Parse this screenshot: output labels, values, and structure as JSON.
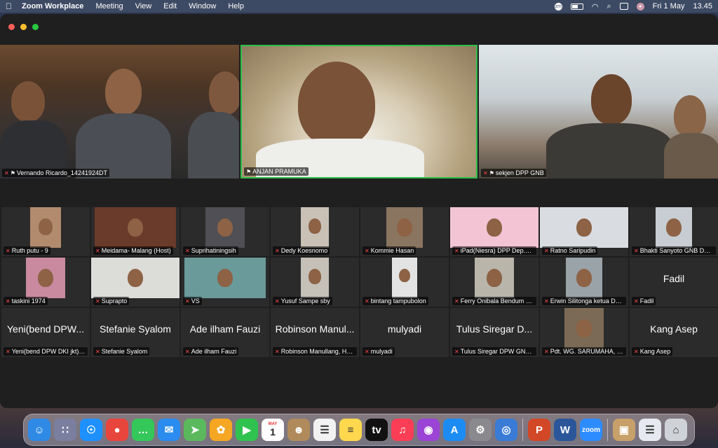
{
  "menubar": {
    "app_name": "Zoom Workplace",
    "menus": [
      "Meeting",
      "View",
      "Edit",
      "Window",
      "Help"
    ],
    "date": "Fri 1 May",
    "time": "13.45"
  },
  "spotlight": [
    {
      "id": "v1",
      "name": "Vernando Ricardo_14241924DT"
    },
    {
      "id": "v2",
      "name": "ANJAN PRAMUKA"
    },
    {
      "id": "v3",
      "name": "sekjen DPP GNB"
    }
  ],
  "grid": [
    {
      "name": "Ruth putu - 9",
      "video": true
    },
    {
      "name": "Meidama- Malang (Host)",
      "video": true
    },
    {
      "name": "Suprihatiningsih",
      "video": true
    },
    {
      "name": "Dedy Koesnomo",
      "video": true
    },
    {
      "name": "Kommie Hasan",
      "video": true
    },
    {
      "name": "iPad(Niesra) DPP Dep.Hu...",
      "video": true
    },
    {
      "name": "Ratno Saripudin",
      "video": true
    },
    {
      "name": "Bhakti Sanyoto GNB DPW...",
      "video": true
    },
    {
      "name": "taskini 1974",
      "video": true
    },
    {
      "name": "Suprapto",
      "video": true
    },
    {
      "name": "VS",
      "video": true
    },
    {
      "name": "Yusuf Sampe sby",
      "video": true
    },
    {
      "name": "bintang tampubolon",
      "video": true
    },
    {
      "name": "Ferry Onibala Bendum DPP",
      "video": true
    },
    {
      "name": "Erwin Silitonga ketua DP...",
      "video": true
    },
    {
      "name": "Fadil",
      "video": false,
      "display": "Fadil"
    },
    {
      "name": "Yeni(bend DPW DKI jkt) d...",
      "video": false,
      "display": "Yeni(bend DPW..."
    },
    {
      "name": "Stefanie Syalom",
      "video": false,
      "display": "Stefanie Syalom"
    },
    {
      "name": "Ade ilham Fauzi",
      "video": false,
      "display": "Ade ilham Fauzi"
    },
    {
      "name": "Robinson Manullang, HU...",
      "video": false,
      "display": "Robinson Manul..."
    },
    {
      "name": "mulyadi",
      "video": false,
      "display": "mulyadi"
    },
    {
      "name": "Tulus Siregar DPW GNB S...",
      "video": false,
      "display": "Tulus Siregar D..."
    },
    {
      "name": "Pdt. WG. SARUMAHA, M.Th",
      "video": true
    },
    {
      "name": "Kang Asep",
      "video": false,
      "display": "Kang Asep"
    }
  ],
  "dock": [
    {
      "name": "finder-icon",
      "label": "☺",
      "color": "#2f8ae5"
    },
    {
      "name": "launchpad-icon",
      "label": "∷",
      "color": "#7a7fa0"
    },
    {
      "name": "safari-icon",
      "label": "☉",
      "color": "#1e90ff"
    },
    {
      "name": "chrome-icon",
      "label": "●",
      "color": "#e8453c"
    },
    {
      "name": "messages-icon",
      "label": "…",
      "color": "#34c759"
    },
    {
      "name": "mail-icon",
      "label": "✉",
      "color": "#2b8cf0"
    },
    {
      "name": "maps-icon",
      "label": "➤",
      "color": "#5bb85d"
    },
    {
      "name": "photos-icon",
      "label": "✿",
      "color": "#f5a623"
    },
    {
      "name": "facetime-icon",
      "label": "▶",
      "color": "#30c24f"
    },
    {
      "name": "calendar-icon",
      "label": "1",
      "color": "#ffffff"
    },
    {
      "name": "contacts-icon",
      "label": "☻",
      "color": "#b08a5a"
    },
    {
      "name": "reminders-icon",
      "label": "☰",
      "color": "#f2f2f2"
    },
    {
      "name": "notes-icon",
      "label": "≡",
      "color": "#ffd84d"
    },
    {
      "name": "apple-tv-icon",
      "label": "tv",
      "color": "#111111"
    },
    {
      "name": "music-icon",
      "label": "♫",
      "color": "#fa3e55"
    },
    {
      "name": "podcasts-icon",
      "label": "◉",
      "color": "#9b44d6"
    },
    {
      "name": "app-store-icon",
      "label": "A",
      "color": "#1c8cf3"
    },
    {
      "name": "system-settings-icon",
      "label": "⚙",
      "color": "#8a8a8e"
    },
    {
      "name": "network-utility-icon",
      "label": "◎",
      "color": "#3a7bd5"
    },
    {
      "name": "powerpoint-icon",
      "label": "P",
      "color": "#d24726"
    },
    {
      "name": "word-icon",
      "label": "W",
      "color": "#2b579a"
    },
    {
      "name": "zoom-icon",
      "label": "zoom",
      "color": "#2d8cff"
    },
    {
      "name": "preview-icon",
      "label": "▣",
      "color": "#c7a06a"
    },
    {
      "name": "document-icon",
      "label": "☰",
      "color": "#e6e9ef"
    },
    {
      "name": "trash-icon",
      "label": "⌂",
      "color": "#cfd3d8"
    }
  ],
  "calendar_badge": "MAY"
}
